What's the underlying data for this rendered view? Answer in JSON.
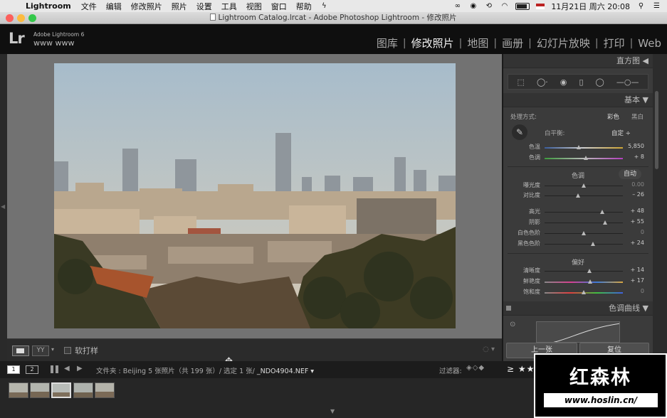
{
  "menubar": {
    "app": "Lightroom",
    "items": [
      "文件",
      "编辑",
      "修改照片",
      "照片",
      "设置",
      "工具",
      "视图",
      "窗口",
      "帮助"
    ],
    "datetime": "11月21日 周六 20:08"
  },
  "window": {
    "title": "Lightroom Catalog.lrcat - Adobe Photoshop Lightroom - 修改照片"
  },
  "header": {
    "logo": "Lr",
    "version": "Adobe Lightroom 6",
    "identity": "www www",
    "modules": [
      "图库",
      "修改照片",
      "地图",
      "画册",
      "幻灯片放映",
      "打印",
      "Web"
    ],
    "active_module": "修改照片"
  },
  "toolbar": {
    "yy_label": "YY",
    "soft_proof_label": "软打样"
  },
  "right_panel": {
    "histogram_label": "直方图",
    "basic_label": "基本",
    "treatment_label": "处理方式:",
    "treatment_color": "彩色",
    "treatment_bw": "黑白",
    "wb_label": "白平衡:",
    "wb_value": "自定 ÷",
    "tone_label": "色调",
    "tone_auto": "自动",
    "presence_label": "偏好",
    "tone_curve_label": "色调曲线",
    "prev_button": "上一张",
    "reset_button": "复位",
    "sliders": {
      "temp": {
        "label": "色温",
        "value": "5,850",
        "pos": 0.44
      },
      "tint": {
        "label": "色调",
        "value": "+ 8",
        "pos": 0.53
      },
      "exposure": {
        "label": "曝光度",
        "value": "0.00",
        "pos": 0.5
      },
      "contrast": {
        "label": "对比度",
        "value": "– 26",
        "pos": 0.43
      },
      "highlights": {
        "label": "高光",
        "value": "+ 48",
        "pos": 0.74
      },
      "shadows": {
        "label": "阴影",
        "value": "+ 55",
        "pos": 0.77
      },
      "whites": {
        "label": "白色色阶",
        "value": "0",
        "pos": 0.5
      },
      "blacks": {
        "label": "黑色色阶",
        "value": "+ 24",
        "pos": 0.62
      },
      "clarity": {
        "label": "清晰度",
        "value": "+ 14",
        "pos": 0.57
      },
      "vibrance": {
        "label": "鲜艳度",
        "value": "+ 17",
        "pos": 0.58
      },
      "saturation": {
        "label": "饱和度",
        "value": "0",
        "pos": 0.5
      }
    }
  },
  "filmstrip_header": {
    "box1": "1",
    "box2": "2",
    "folder_info": "文件夹 : Beijing   5 张照片（共 199 张）/ 选定 1 张/",
    "file": " _NDO4904.NEF ▾",
    "filter_label": "过滤器:",
    "rating": "≥ ★★★★★"
  },
  "watermark": {
    "title": "红森林",
    "url": "www.hoslin.cn/"
  },
  "colors": {
    "menubar_bg": "#e8e8e8",
    "panel_bg": "#3b3b3b",
    "center_bg": "#727272"
  }
}
